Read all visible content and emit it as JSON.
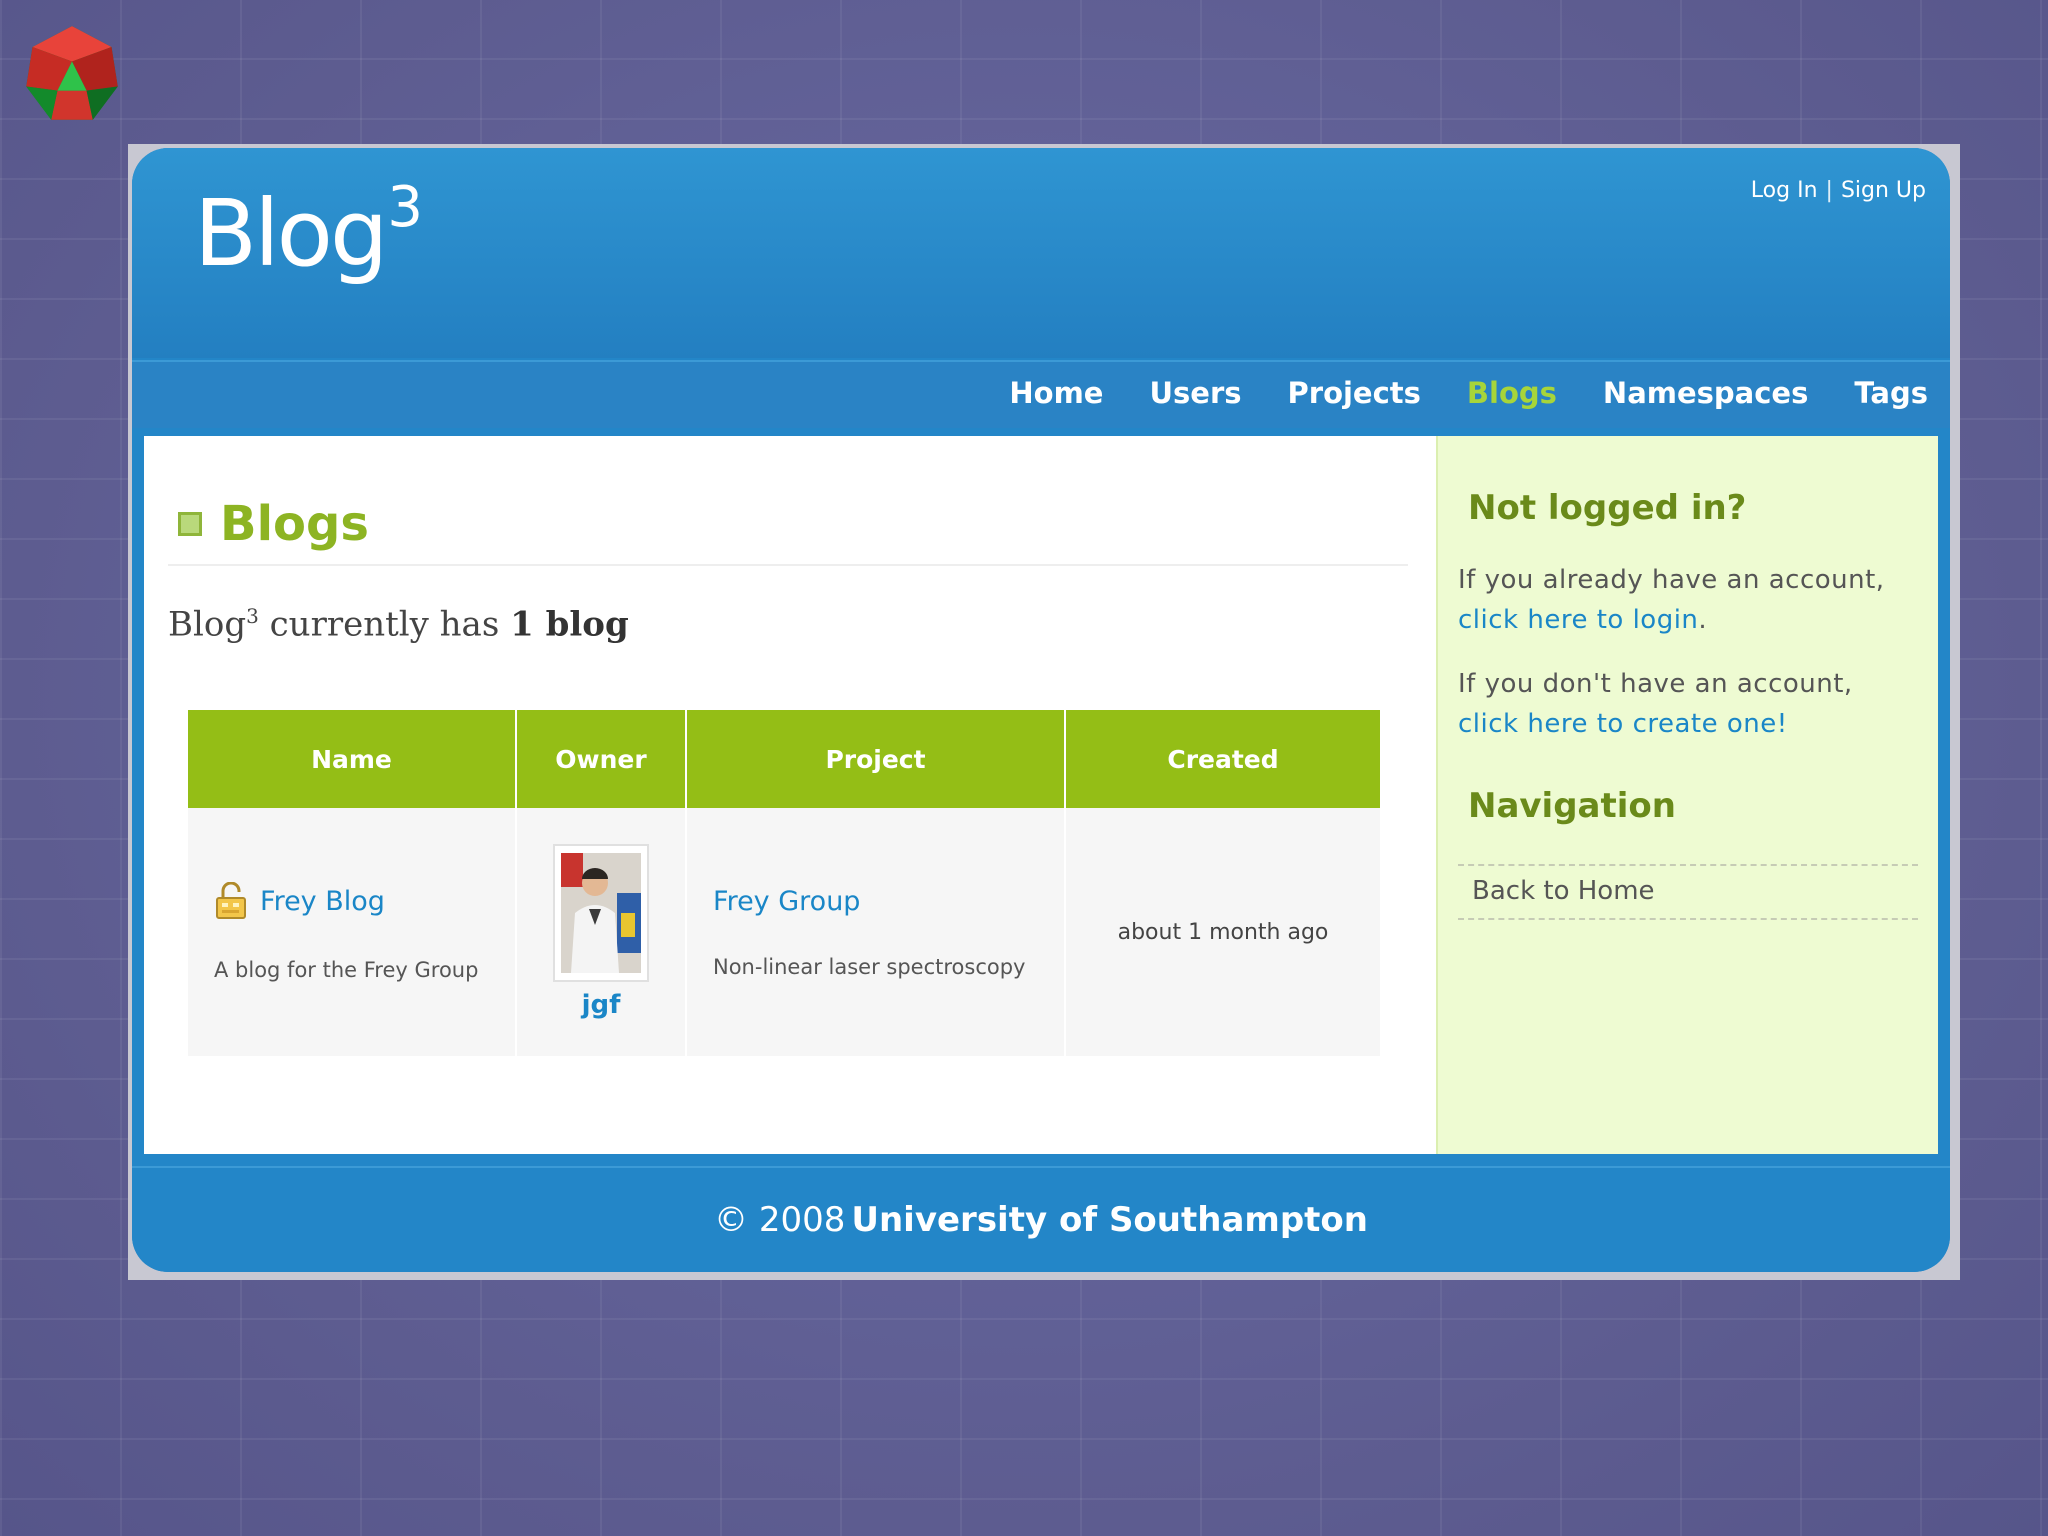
{
  "site": {
    "brand_main": "Blog",
    "brand_sup": "3",
    "auth": {
      "login": "Log In",
      "separator": "|",
      "signup": "Sign Up"
    }
  },
  "nav": {
    "items": [
      "Home",
      "Users",
      "Projects",
      "Blogs",
      "Namespaces",
      "Tags"
    ],
    "active": "Blogs"
  },
  "main": {
    "title": "Blogs",
    "summary": {
      "prefix": "Blog",
      "sup": "3",
      "middle": " currently has ",
      "count": "1 blog"
    },
    "table": {
      "headers": [
        "Name",
        "Owner",
        "Project",
        "Created"
      ],
      "rows": [
        {
          "name": "Frey Blog",
          "description": "A blog for the Frey Group",
          "owner": "jgf",
          "project": "Frey Group",
          "project_desc": "Non-linear laser spectroscopy",
          "created": "about 1 month ago"
        }
      ]
    }
  },
  "sidebar": {
    "heading1": "Not logged in?",
    "p1_text": "If you already have an account,",
    "p1_link": "click here to login",
    "p1_end": ".",
    "p2_text": "If you don't have an account,",
    "p2_link": "click here to create one!",
    "heading2": "Navigation",
    "nav_link": "Back to Home"
  },
  "footer": {
    "prefix": "© 2008",
    "org": "University of Southampton"
  },
  "colors": {
    "blue": "#2386c8",
    "green": "#94be16",
    "active_nav": "#a7d53a",
    "link": "#1a86c7",
    "sidebar_bg": "#eefbd2"
  }
}
